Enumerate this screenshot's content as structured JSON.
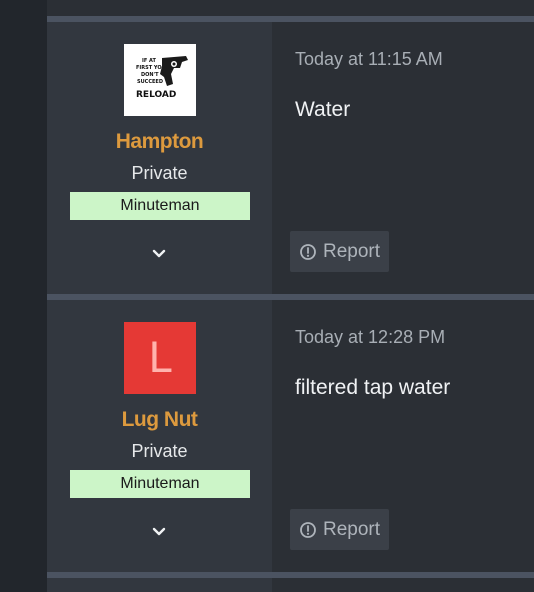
{
  "thread": {
    "posts": [
      {
        "username": "Hampton",
        "rank": "Private",
        "badge": "Minuteman",
        "avatar_type": "image",
        "avatar_text": "IF AT FIRST YOU DON'T SUCCEED RELOAD",
        "timestamp": "Today at 11:15 AM",
        "body": "Water",
        "report_label": "Report"
      },
      {
        "username": "Lug Nut",
        "rank": "Private",
        "badge": "Minuteman",
        "avatar_type": "letter",
        "avatar_letter": "L",
        "avatar_color": "#e53935",
        "timestamp": "Today at 12:28 PM",
        "body": "filtered tap water",
        "report_label": "Report"
      }
    ]
  },
  "colors": {
    "username": "#dd9a3e",
    "badge_bg": "#ccf5c8",
    "separator": "#4b5361",
    "user_cell_bg": "#32373f",
    "content_bg": "#2b2f35"
  },
  "icons": {
    "expand": "chevron-down-icon",
    "report": "alert-circle-icon"
  }
}
